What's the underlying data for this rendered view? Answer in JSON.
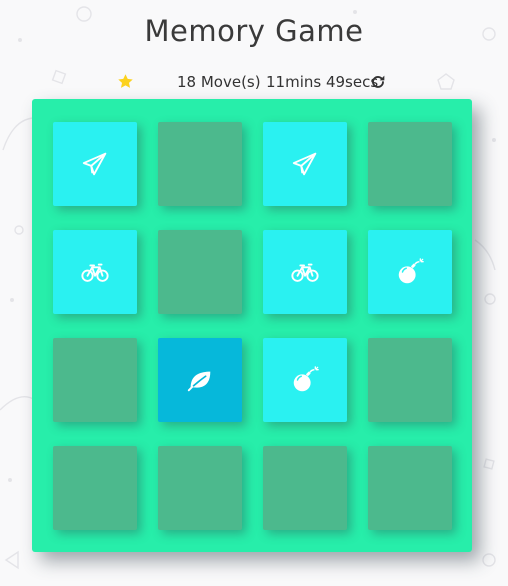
{
  "header": {
    "title": "Memory Game"
  },
  "score_panel": {
    "stars": 1,
    "moves": "18 Move(s)",
    "timer": "11mins 49secs",
    "restart_icon": "redo-icon"
  },
  "colors": {
    "deck": "#27eeaa",
    "card_closed": "#4cb98d",
    "card_matched": "#2af1f1",
    "card_open": "#06b8da",
    "star": "#fcd21e"
  },
  "deck": {
    "cards": [
      {
        "state": "match",
        "icon": "paper-plane"
      },
      {
        "state": "closed",
        "icon": ""
      },
      {
        "state": "match",
        "icon": "paper-plane"
      },
      {
        "state": "closed",
        "icon": ""
      },
      {
        "state": "match",
        "icon": "bicycle"
      },
      {
        "state": "closed",
        "icon": ""
      },
      {
        "state": "match",
        "icon": "bicycle"
      },
      {
        "state": "match",
        "icon": "bomb"
      },
      {
        "state": "closed",
        "icon": ""
      },
      {
        "state": "open",
        "icon": "leaf"
      },
      {
        "state": "match",
        "icon": "bomb"
      },
      {
        "state": "closed",
        "icon": ""
      },
      {
        "state": "closed",
        "icon": ""
      },
      {
        "state": "closed",
        "icon": ""
      },
      {
        "state": "closed",
        "icon": ""
      },
      {
        "state": "closed",
        "icon": ""
      }
    ]
  }
}
